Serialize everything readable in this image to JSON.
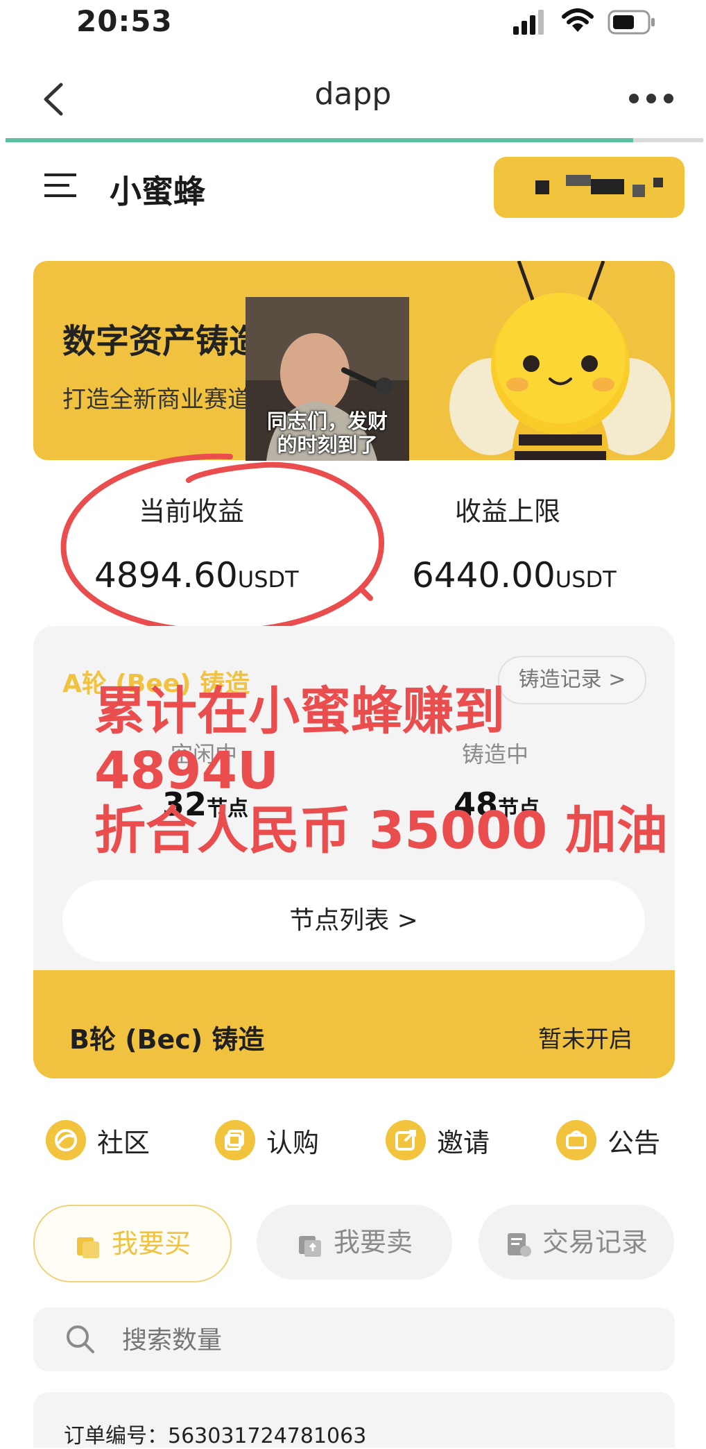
{
  "status_bar": {
    "time": "20:53"
  },
  "nav": {
    "title": "dapp",
    "page_load_progress": 0.9
  },
  "header": {
    "title": "小蜜蜂"
  },
  "banner": {
    "title": "数字资产铸造",
    "subtitle": "打造全新商业赛道"
  },
  "meme": {
    "caption_line1": "同志们，发财",
    "caption_line2": "的时刻到了"
  },
  "earnings": {
    "current_label": "当前收益",
    "current_value": "4894.60",
    "current_unit": "USDT",
    "limit_label": "收益上限",
    "limit_value": "6440.00",
    "limit_unit": "USDT"
  },
  "mint_a": {
    "title": "A轮 (Bee) 铸造",
    "records_label": "铸造记录 >",
    "idle_label": "空闲中",
    "idle_count": "32",
    "idle_unit": "节点",
    "minting_label": "铸造中",
    "minting_count": "48",
    "minting_unit": "节点",
    "node_list_label": "节点列表 >"
  },
  "mint_b": {
    "title": "B轮 (Bec) 铸造",
    "status": "暂未开启"
  },
  "overlay": {
    "line1": "累计在小蜜蜂赚到",
    "line2": "4894U",
    "line3": "折合人民币 35000 加油"
  },
  "quick_actions": [
    {
      "label": "社区",
      "icon": "community-icon"
    },
    {
      "label": "认购",
      "icon": "subscribe-icon"
    },
    {
      "label": "邀请",
      "icon": "invite-icon"
    },
    {
      "label": "公告",
      "icon": "announcement-icon"
    }
  ],
  "trade_tabs": [
    {
      "label": "我要买",
      "icon": "buy-icon",
      "active": true
    },
    {
      "label": "我要卖",
      "icon": "sell-icon",
      "active": false
    },
    {
      "label": "交易记录",
      "icon": "records-icon",
      "active": false
    }
  ],
  "search": {
    "placeholder": "搜索数量"
  },
  "order": {
    "label": "订单编号：",
    "number": "563031724781063"
  },
  "colors": {
    "accent": "#f0c23f",
    "overlay_red": "#ea4d4d",
    "progress": "#5ec0a0"
  }
}
